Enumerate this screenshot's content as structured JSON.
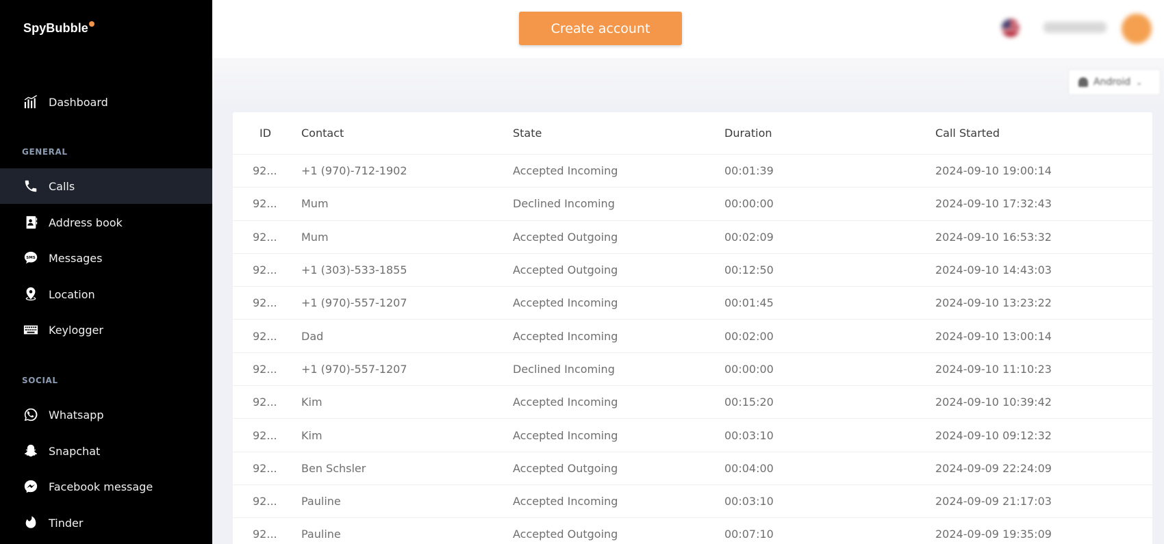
{
  "app": {
    "logo": "SpyBubble"
  },
  "sidebar": {
    "dashboard": {
      "label": "Dashboard",
      "icon": "dashboard-chart-icon"
    },
    "general_label": "GENERAL",
    "general_items": [
      {
        "label": "Calls",
        "icon": "phone-icon",
        "active": true
      },
      {
        "label": "Address book",
        "icon": "contact-book-icon"
      },
      {
        "label": "Messages",
        "icon": "sms-bubble-icon"
      },
      {
        "label": "Location",
        "icon": "location-pin-icon"
      },
      {
        "label": "Keylogger",
        "icon": "keyboard-icon"
      }
    ],
    "social_label": "SOCIAL",
    "social_items": [
      {
        "label": "Whatsapp",
        "icon": "whatsapp-icon"
      },
      {
        "label": "Snapchat",
        "icon": "snapchat-ghost-icon"
      },
      {
        "label": "Facebook message",
        "icon": "messenger-icon"
      },
      {
        "label": "Tinder",
        "icon": "tinder-flame-icon"
      }
    ]
  },
  "header": {
    "create_account_label": "Create account"
  },
  "subbar": {
    "device_os": "Android"
  },
  "calls_table": {
    "columns": [
      "ID",
      "Contact",
      "State",
      "Duration",
      "Call Started"
    ],
    "rows": [
      [
        "92...",
        "+1 (970)-712-1902",
        "Accepted Incoming",
        "00:01:39",
        "2024-09-10 19:00:14"
      ],
      [
        "92...",
        "Mum",
        "Declined Incoming",
        "00:00:00",
        "2024-09-10 17:32:43"
      ],
      [
        "92...",
        "Mum",
        "Accepted Outgoing",
        "00:02:09",
        "2024-09-10 16:53:32"
      ],
      [
        "92...",
        "+1 (303)-533-1855",
        "Accepted Outgoing",
        "00:12:50",
        "2024-09-10 14:43:03"
      ],
      [
        "92...",
        "+1 (970)-557-1207",
        "Accepted Incoming",
        "00:01:45",
        "2024-09-10 13:23:22"
      ],
      [
        "92...",
        "Dad",
        "Accepted Incoming",
        "00:02:00",
        "2024-09-10 13:00:14"
      ],
      [
        "92...",
        "+1 (970)-557-1207",
        "Declined Incoming",
        "00:00:00",
        "2024-09-10 11:10:23"
      ],
      [
        "92...",
        "Kim",
        "Accepted Incoming",
        "00:15:20",
        "2024-09-10 10:39:42"
      ],
      [
        "92...",
        "Kim",
        "Accepted Incoming",
        "00:03:10",
        "2024-09-10 09:12:32"
      ],
      [
        "92...",
        "Ben Schsler",
        "Accepted Outgoing",
        "00:04:00",
        "2024-09-09 22:24:09"
      ],
      [
        "92...",
        "Pauline",
        "Accepted Incoming",
        "00:03:10",
        "2024-09-09 21:17:03"
      ],
      [
        "92...",
        "Pauline",
        "Accepted Outgoing",
        "00:07:10",
        "2024-09-09 19:35:09"
      ]
    ]
  },
  "colors": {
    "accent": "#f4974a",
    "sidebar_bg": "#000000",
    "active_item_bg": "#1f232e",
    "section_label": "#8a9bb2"
  }
}
